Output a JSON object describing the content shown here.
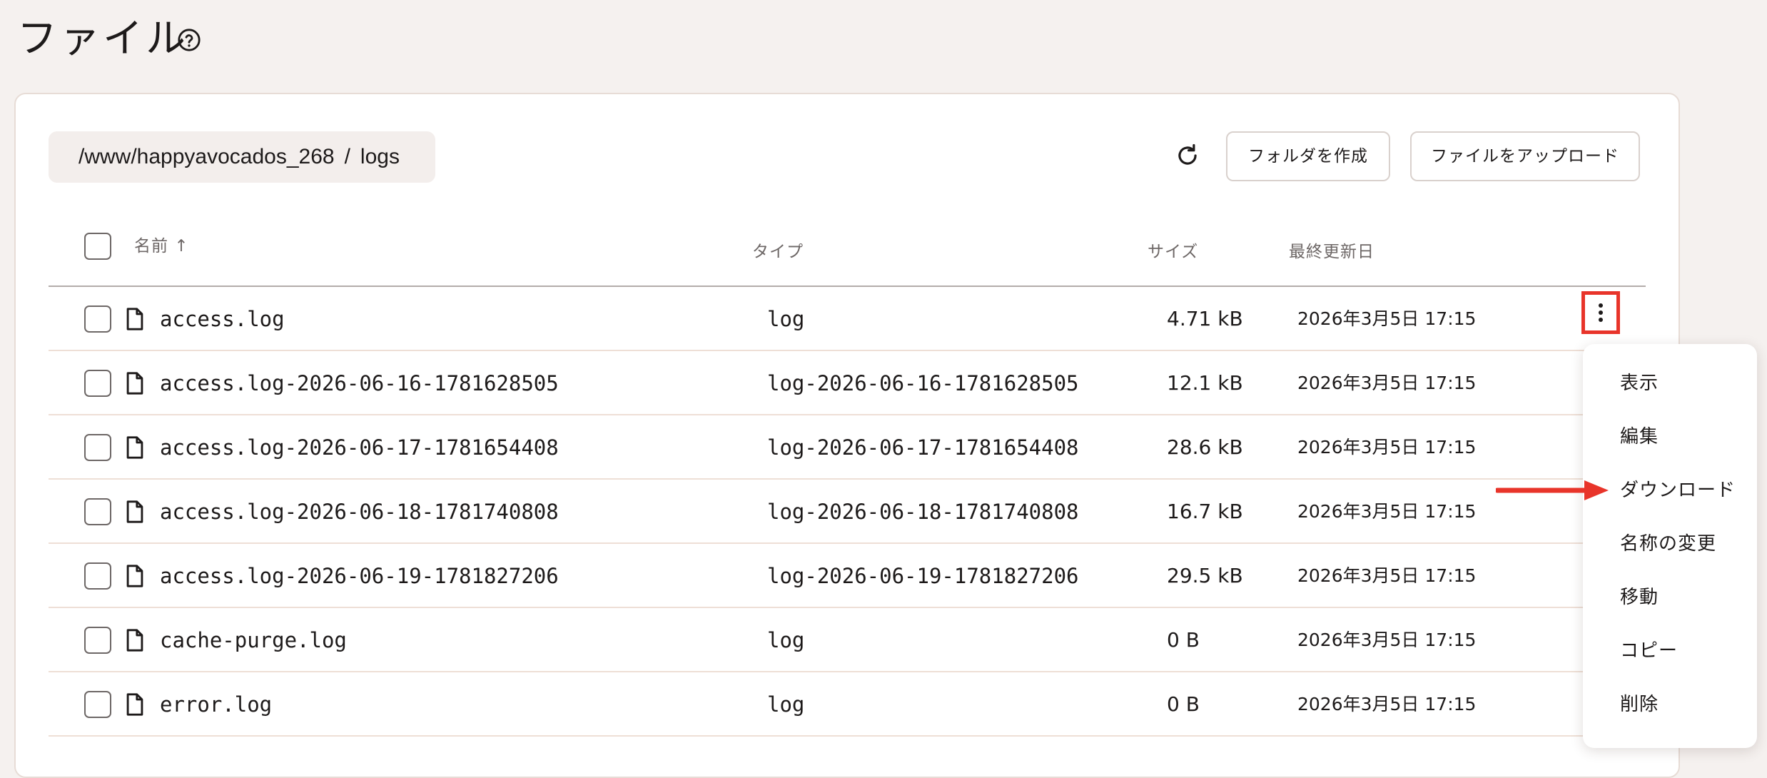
{
  "header": {
    "title": "ファイル",
    "help_icon": "question-circle-icon"
  },
  "toolbar": {
    "path_root": "/www/happyavocados_268",
    "path_separator": "/",
    "path_current": "logs",
    "refresh_icon": "refresh-icon",
    "create_folder_label": "フォルダを作成",
    "upload_file_label": "ファイルをアップロード"
  },
  "table": {
    "columns": {
      "name": "名前",
      "sort_indicator": "↑",
      "type": "タイプ",
      "size": "サイズ",
      "modified": "最終更新日"
    },
    "rows": [
      {
        "name": "access.log",
        "type": "log",
        "size": "4.71 kB",
        "modified": "2026年3月5日 17:15"
      },
      {
        "name": "access.log-2026-06-16-1781628505",
        "type": "log-2026-06-16-1781628505",
        "size": "12.1 kB",
        "modified": "2026年3月5日 17:15"
      },
      {
        "name": "access.log-2026-06-17-1781654408",
        "type": "log-2026-06-17-1781654408",
        "size": "28.6 kB",
        "modified": "2026年3月5日 17:15"
      },
      {
        "name": "access.log-2026-06-18-1781740808",
        "type": "log-2026-06-18-1781740808",
        "size": "16.7 kB",
        "modified": "2026年3月5日 17:15"
      },
      {
        "name": "access.log-2026-06-19-1781827206",
        "type": "log-2026-06-19-1781827206",
        "size": "29.5 kB",
        "modified": "2026年3月5日 17:15"
      },
      {
        "name": "cache-purge.log",
        "type": "log",
        "size": "0 B",
        "modified": "2026年3月5日 17:15"
      },
      {
        "name": "error.log",
        "type": "log",
        "size": "0 B",
        "modified": "2026年3月5日 17:15"
      }
    ]
  },
  "context_menu": {
    "items": [
      "表示",
      "編集",
      "ダウンロード",
      "名称の変更",
      "移動",
      "コピー",
      "削除"
    ]
  },
  "colors": {
    "highlight": "#e8342a",
    "background": "#f5f1ef",
    "row_divider": "#eedfd6"
  }
}
